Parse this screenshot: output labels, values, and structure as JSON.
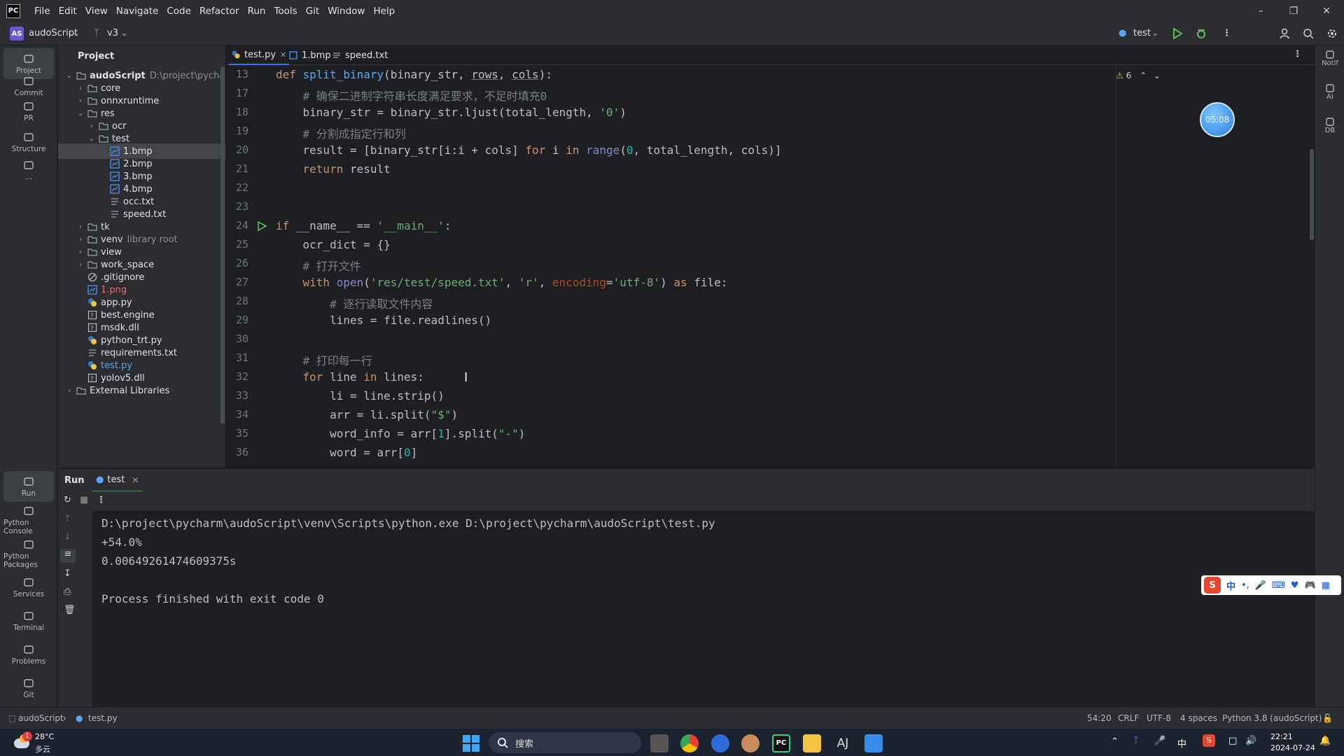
{
  "menu": [
    "File",
    "Edit",
    "View",
    "Navigate",
    "Code",
    "Refactor",
    "Run",
    "Tools",
    "Git",
    "Window",
    "Help"
  ],
  "toolbar": {
    "project_badge": "AS",
    "project_name": "audoScript",
    "branch": "v3",
    "run_config": "test"
  },
  "left_tools": [
    {
      "label": "Project",
      "icon": "folder-icon"
    },
    {
      "label": "Commit",
      "icon": "commit-icon"
    },
    {
      "label": "PR",
      "icon": "pull-request-icon"
    },
    {
      "label": "Structure",
      "icon": "structure-icon"
    },
    {
      "label": "...",
      "icon": "more-icon"
    }
  ],
  "bottom_left_tools": [
    {
      "label": "Run",
      "icon": "run-icon"
    },
    {
      "label": "Python Console",
      "icon": "python-console-icon"
    },
    {
      "label": "Python Packages",
      "icon": "packages-icon"
    },
    {
      "label": "Services",
      "icon": "services-icon"
    },
    {
      "label": "Terminal",
      "icon": "terminal-icon"
    },
    {
      "label": "Problems",
      "icon": "problems-icon"
    },
    {
      "label": "Git",
      "icon": "git-icon"
    }
  ],
  "right_tools": [
    {
      "label": "Notif",
      "icon": "bell-icon"
    },
    {
      "label": "AI",
      "icon": "ai-icon"
    },
    {
      "label": "DB",
      "icon": "database-icon"
    }
  ],
  "project_panel": {
    "title": "Project",
    "tree": [
      {
        "name": "audoScript",
        "extra": "D:\\project\\pycha",
        "type": "folder",
        "level": 0,
        "open": true,
        "bold": true
      },
      {
        "name": "core",
        "type": "folder",
        "level": 1,
        "open": false
      },
      {
        "name": "onnxruntime",
        "type": "folder",
        "level": 1,
        "open": false
      },
      {
        "name": "res",
        "type": "folder",
        "level": 1,
        "open": true
      },
      {
        "name": "ocr",
        "type": "folder",
        "level": 2,
        "open": false
      },
      {
        "name": "test",
        "type": "folder",
        "level": 2,
        "open": true
      },
      {
        "name": "1.bmp",
        "type": "image",
        "level": 3,
        "selected": true
      },
      {
        "name": "2.bmp",
        "type": "image",
        "level": 3
      },
      {
        "name": "3.bmp",
        "type": "image",
        "level": 3
      },
      {
        "name": "4.bmp",
        "type": "image",
        "level": 3
      },
      {
        "name": "occ.txt",
        "type": "text",
        "level": 3
      },
      {
        "name": "speed.txt",
        "type": "text",
        "level": 3
      },
      {
        "name": "tk",
        "type": "folder",
        "level": 1,
        "open": false
      },
      {
        "name": "venv",
        "extra": "library root",
        "type": "folder",
        "level": 1,
        "open": false
      },
      {
        "name": "view",
        "type": "folder",
        "level": 1,
        "open": false
      },
      {
        "name": "work_space",
        "type": "folder",
        "level": 1,
        "open": false
      },
      {
        "name": ".gitignore",
        "type": "ignore",
        "level": 1
      },
      {
        "name": "1.png",
        "type": "image",
        "level": 1,
        "color": "#e06c75"
      },
      {
        "name": "app.py",
        "type": "python",
        "level": 1
      },
      {
        "name": "best.engine",
        "type": "unknown",
        "level": 1
      },
      {
        "name": "msdk.dll",
        "type": "unknown",
        "level": 1
      },
      {
        "name": "python_trt.py",
        "type": "python",
        "level": 1
      },
      {
        "name": "requirements.txt",
        "type": "text",
        "level": 1
      },
      {
        "name": "test.py",
        "type": "python",
        "level": 1,
        "color": "#56a8f5"
      },
      {
        "name": "yolov5.dll",
        "type": "unknown",
        "level": 1
      },
      {
        "name": "External Libraries",
        "type": "library",
        "level": 0,
        "open": false
      }
    ]
  },
  "tabs": [
    {
      "label": "test.py",
      "icon": "python-file-icon",
      "active": true,
      "closable": true
    },
    {
      "label": "1.bmp",
      "icon": "image-file-icon"
    },
    {
      "label": "speed.txt",
      "icon": "text-file-icon"
    }
  ],
  "editor": {
    "warning_count": "6",
    "lines": [
      {
        "num": "13",
        "tokens": [
          [
            "kw",
            "def "
          ],
          [
            "fn",
            "split_binary"
          ],
          [
            "",
            "(binary_str, "
          ],
          [
            "u",
            "rows"
          ],
          [
            "",
            ", "
          ],
          [
            "u",
            "cols"
          ],
          [
            "",
            "):"
          ]
        ]
      },
      {
        "num": "17",
        "tokens": [
          [
            "cm",
            "    # 确保二进制字符串长度满足要求，不足时填充0"
          ]
        ]
      },
      {
        "num": "18",
        "tokens": [
          [
            "",
            "    binary_str = binary_str.ljust(total_length, "
          ],
          [
            "str",
            "'0'"
          ],
          [
            "",
            ")"
          ]
        ]
      },
      {
        "num": "19",
        "tokens": [
          [
            "cm",
            "    # 分割成指定行和列"
          ]
        ]
      },
      {
        "num": "20",
        "tokens": [
          [
            "",
            "    result = [binary_str[i:i + cols] "
          ],
          [
            "kw",
            "for"
          ],
          [
            "",
            " i "
          ],
          [
            "kw",
            "in"
          ],
          [
            "",
            " "
          ],
          [
            "bi",
            "range"
          ],
          [
            "",
            "("
          ],
          [
            "num",
            "0"
          ],
          [
            "",
            ", total_length, cols)]"
          ]
        ]
      },
      {
        "num": "21",
        "tokens": [
          [
            "kw",
            "    return"
          ],
          [
            "",
            " result"
          ]
        ]
      },
      {
        "num": "22",
        "tokens": []
      },
      {
        "num": "23",
        "tokens": []
      },
      {
        "num": "24",
        "tokens": [
          [
            "kw",
            "if"
          ],
          [
            "",
            " __name__ == "
          ],
          [
            "str",
            "'__main__'"
          ],
          [
            "",
            ":"
          ]
        ],
        "run": true
      },
      {
        "num": "25",
        "tokens": [
          [
            "",
            "    ocr_dict = {}"
          ]
        ]
      },
      {
        "num": "26",
        "tokens": [
          [
            "cm",
            "    # 打开文件"
          ]
        ]
      },
      {
        "num": "27",
        "tokens": [
          [
            "kw",
            "    with"
          ],
          [
            "",
            " "
          ],
          [
            "bi",
            "open"
          ],
          [
            "",
            "("
          ],
          [
            "str",
            "'res/test/speed.txt'"
          ],
          [
            "",
            ", "
          ],
          [
            "str",
            "'r'"
          ],
          [
            "",
            ", "
          ],
          [
            "param",
            "encoding"
          ],
          [
            "",
            "="
          ],
          [
            "str",
            "'utf-8'"
          ],
          [
            "",
            ") "
          ],
          [
            "kw",
            "as"
          ],
          [
            "",
            " file:"
          ]
        ]
      },
      {
        "num": "28",
        "tokens": [
          [
            "cm",
            "        # 逐行读取文件内容"
          ]
        ]
      },
      {
        "num": "29",
        "tokens": [
          [
            "",
            "        lines = file.readlines()"
          ]
        ]
      },
      {
        "num": "30",
        "tokens": []
      },
      {
        "num": "31",
        "tokens": [
          [
            "cm",
            "    # 打印每一行"
          ]
        ]
      },
      {
        "num": "32",
        "tokens": [
          [
            "kw",
            "    for"
          ],
          [
            "",
            " line "
          ],
          [
            "kw",
            "in"
          ],
          [
            "",
            " lines:"
          ]
        ]
      },
      {
        "num": "33",
        "tokens": [
          [
            "",
            "        li = line.strip()"
          ]
        ]
      },
      {
        "num": "34",
        "tokens": [
          [
            "",
            "        arr = li.split("
          ],
          [
            "str",
            "\"$\""
          ],
          [
            "",
            ")"
          ]
        ]
      },
      {
        "num": "35",
        "tokens": [
          [
            "",
            "        word_info = arr["
          ],
          [
            "num",
            "1"
          ],
          [
            "",
            "].split("
          ],
          [
            "str",
            "\"-\""
          ],
          [
            "",
            ")"
          ]
        ]
      },
      {
        "num": "36",
        "tokens": [
          [
            "",
            "        word = arr["
          ],
          [
            "num",
            "0"
          ],
          [
            "",
            "]"
          ]
        ]
      }
    ]
  },
  "run_panel": {
    "title": "Run",
    "tab": "test",
    "output": [
      "D:\\project\\pycharm\\audoScript\\venv\\Scripts\\python.exe D:\\project\\pycharm\\audoScript\\test.py",
      "+54.0%",
      "0.00649261474609375s",
      "",
      "Process finished with exit code 0"
    ]
  },
  "statusbar": {
    "crumb_project": "audoScript",
    "crumb_file": "test.py",
    "position": "54:20",
    "line_sep": "CRLF",
    "encoding": "UTF-8",
    "indent": "4 spaces",
    "interpreter": "Python 3.8 (audoScript)"
  },
  "taskbar": {
    "weather_temp": "28°C",
    "weather_desc": "多云",
    "weather_badge": "1",
    "search_placeholder": "搜索",
    "time": "22:21",
    "date": "2024-07-24",
    "ime": "中",
    "ime_bar": "中"
  },
  "overlay_timer": "05:08",
  "colors": {
    "accent": "#3574f0",
    "bg": "#1e1f22",
    "panel": "#2b2d30"
  }
}
